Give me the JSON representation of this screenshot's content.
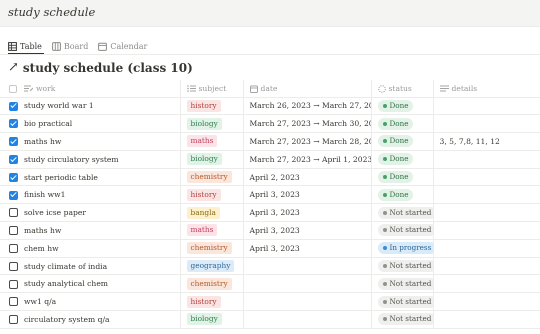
{
  "page": {
    "title": "study schedule"
  },
  "views": [
    {
      "label": "Table",
      "icon": "table-icon",
      "active": true
    },
    {
      "label": "Board",
      "icon": "board-icon",
      "active": false
    },
    {
      "label": "Calendar",
      "icon": "calendar-icon",
      "active": false
    }
  ],
  "database": {
    "title": "study schedule (class 10)",
    "link_icon": "arrow-up-right-icon"
  },
  "columns": {
    "work": "work",
    "subject": "subject",
    "date": "date",
    "status": "status",
    "details": "details"
  },
  "colors": {
    "tags": {
      "history": {
        "bg": "#fbe4e4",
        "fg": "#b0433e"
      },
      "biology": {
        "bg": "#e1f3e6",
        "fg": "#2f7d4f"
      },
      "maths": {
        "bg": "#fde2e7",
        "fg": "#c0425f"
      },
      "chemistry": {
        "bg": "#fbe6db",
        "fg": "#b25a2f"
      },
      "bangla": {
        "bg": "#fdf0cc",
        "fg": "#8a6a10"
      },
      "geography": {
        "bg": "#dcebf7",
        "fg": "#2c6aa0"
      }
    },
    "status": {
      "Done": {
        "bg": "#e2f2e6",
        "fg": "#33704a",
        "dot": "#4aa06a"
      },
      "Not started": {
        "bg": "#efefed",
        "fg": "#55534e",
        "dot": "#91918e"
      },
      "In progress": {
        "bg": "#d9ebf8",
        "fg": "#2b6596",
        "dot": "#3c8bd0"
      }
    },
    "checkbox": "#2383e2"
  },
  "rows": [
    {
      "done": true,
      "work": "study world war 1",
      "subject": "history",
      "date": "March 26, 2023 → March 27, 2023",
      "status": "Done",
      "details": ""
    },
    {
      "done": true,
      "work": "bio practical",
      "subject": "biology",
      "date": "March 27, 2023 → March 30, 2023",
      "status": "Done",
      "details": ""
    },
    {
      "done": true,
      "work": "maths hw",
      "subject": "maths",
      "date": "March 27, 2023 → March 28, 2023",
      "status": "Done",
      "details": "3, 5, 7,8, 11, 12"
    },
    {
      "done": true,
      "work": "study circulatory system",
      "subject": "biology",
      "date": "March 27, 2023 → April 1, 2023",
      "status": "Done",
      "details": ""
    },
    {
      "done": true,
      "work": "start periodic table",
      "subject": "chemistry",
      "date": "April 2, 2023",
      "status": "Done",
      "details": ""
    },
    {
      "done": true,
      "work": "finish ww1",
      "subject": "history",
      "date": "April 3, 2023",
      "status": "Done",
      "details": ""
    },
    {
      "done": false,
      "work": "solve icse paper",
      "subject": "bangla",
      "date": "April 3, 2023",
      "status": "Not started",
      "details": ""
    },
    {
      "done": false,
      "work": "maths hw",
      "subject": "maths",
      "date": "April 3, 2023",
      "status": "Not started",
      "details": ""
    },
    {
      "done": false,
      "work": "chem hw",
      "subject": "chemistry",
      "date": "April 3, 2023",
      "status": "In progress",
      "details": ""
    },
    {
      "done": false,
      "work": "study climate of india",
      "subject": "geography",
      "date": "",
      "status": "Not started",
      "details": ""
    },
    {
      "done": false,
      "work": "study analytical chem",
      "subject": "chemistry",
      "date": "",
      "status": "Not started",
      "details": ""
    },
    {
      "done": false,
      "work": "ww1 q/a",
      "subject": "history",
      "date": "",
      "status": "Not started",
      "details": ""
    },
    {
      "done": false,
      "work": "circulatory system q/a",
      "subject": "biology",
      "date": "",
      "status": "Not started",
      "details": ""
    }
  ]
}
